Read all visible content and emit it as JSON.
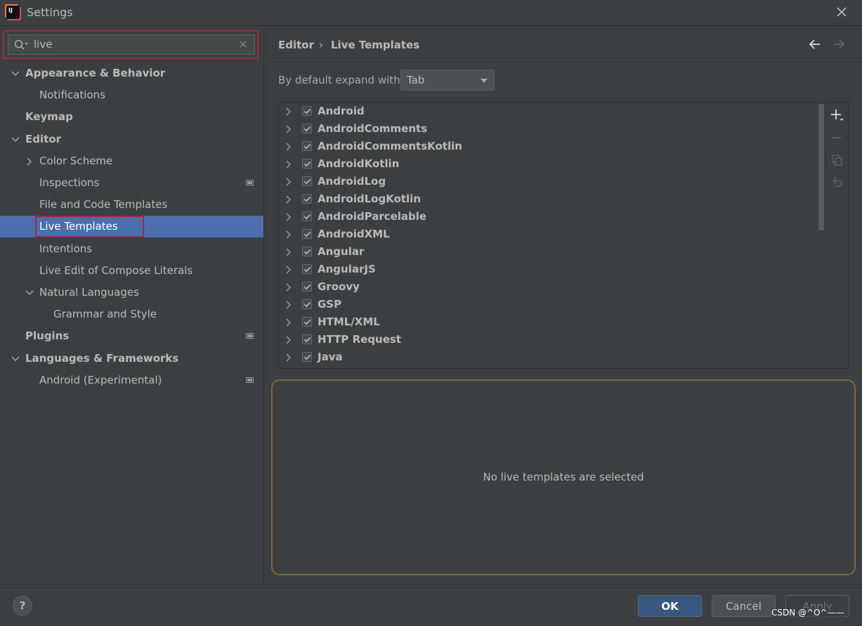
{
  "window": {
    "title": "Settings"
  },
  "search": {
    "value": "live"
  },
  "sidebar": {
    "items": [
      {
        "label": "Appearance & Behavior",
        "bold": true,
        "expanded": true,
        "indent": 0
      },
      {
        "label": "Notifications",
        "bold": false,
        "indent": 1
      },
      {
        "label": "Keymap",
        "bold": true,
        "indent": 0
      },
      {
        "label": "Editor",
        "bold": true,
        "expanded": true,
        "indent": 0
      },
      {
        "label": "Color Scheme",
        "bold": false,
        "expanded": false,
        "indent": 1
      },
      {
        "label": "Inspections",
        "bold": false,
        "indent": 1,
        "project_icon": true
      },
      {
        "label": "File and Code Templates",
        "bold": false,
        "indent": 1
      },
      {
        "label": "Live Templates",
        "bold": false,
        "indent": 1,
        "selected": true
      },
      {
        "label": "Intentions",
        "bold": false,
        "indent": 1
      },
      {
        "label": "Live Edit of Compose Literals",
        "bold": false,
        "indent": 1
      },
      {
        "label": "Natural Languages",
        "bold": false,
        "expanded": true,
        "indent": 1
      },
      {
        "label": "Grammar and Style",
        "bold": false,
        "indent": 2
      },
      {
        "label": "Plugins",
        "bold": true,
        "indent": 0,
        "project_icon": true
      },
      {
        "label": "Languages & Frameworks",
        "bold": true,
        "expanded": true,
        "indent": 0
      },
      {
        "label": "Android (Experimental)",
        "bold": false,
        "indent": 1,
        "project_icon": true
      }
    ]
  },
  "breadcrumb": {
    "parent": "Editor",
    "separator": "›",
    "current": "Live Templates"
  },
  "expand": {
    "label": "By default expand with",
    "value": "Tab"
  },
  "templates": [
    {
      "name": "Android",
      "checked": true
    },
    {
      "name": "AndroidComments",
      "checked": true
    },
    {
      "name": "AndroidCommentsKotlin",
      "checked": true
    },
    {
      "name": "AndroidKotlin",
      "checked": true
    },
    {
      "name": "AndroidLog",
      "checked": true
    },
    {
      "name": "AndroidLogKotlin",
      "checked": true
    },
    {
      "name": "AndroidParcelable",
      "checked": true
    },
    {
      "name": "AndroidXML",
      "checked": true
    },
    {
      "name": "Angular",
      "checked": true
    },
    {
      "name": "AngularJS",
      "checked": true
    },
    {
      "name": "Groovy",
      "checked": true
    },
    {
      "name": "GSP",
      "checked": true
    },
    {
      "name": "HTML/XML",
      "checked": true
    },
    {
      "name": "HTTP Request",
      "checked": true
    },
    {
      "name": "Java",
      "checked": true
    }
  ],
  "detail": {
    "message": "No live templates are selected"
  },
  "footer": {
    "help": "?",
    "ok": "OK",
    "cancel": "Cancel",
    "apply": "Apply"
  },
  "watermark": "CSDN @^O^——",
  "colors": {
    "background": "#3c3f41",
    "selection": "#4b6eaf",
    "highlight_outline": "#a3283d",
    "ok_button": "#365880"
  }
}
